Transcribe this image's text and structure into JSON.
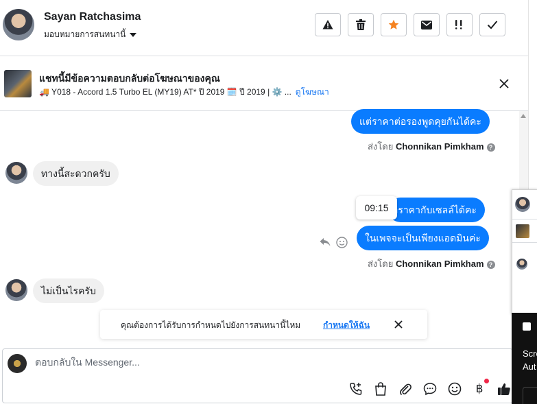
{
  "header": {
    "contact_name": "Sayan Ratchasima",
    "assign_label": "มอบหมายการสนทนานี้",
    "toolbar": {
      "spam_icon": "alert-triangle-icon",
      "delete_icon": "trash-icon",
      "star_icon": "star-icon",
      "unread_icon": "envelope-icon",
      "priority_icon": "priority-icon",
      "done_icon": "checkmark-icon",
      "star_color": "#f5821f"
    }
  },
  "ad_banner": {
    "title": "แชทนี้มีข้อความตอบกลับต่อโฆษณาของคุณ",
    "subtitle": "🚚 Y018 - Accord 1.5 Turbo EL (MY19) AT* ปี 2019 🗓️ ปี 2019 | ⚙️ ...",
    "link": "ดูโฆษณา"
  },
  "messages": [
    {
      "direction": "out",
      "text": "แต่ราคาต่อรองพูดคุยกันได้คะ"
    },
    {
      "direction": "sent_by",
      "prefix": "ส่งโดย",
      "name": "Chonnikan Pimkham"
    },
    {
      "direction": "in",
      "text": "ทางนี้สะดวกครับ"
    },
    {
      "direction": "out",
      "text": "อราคากับเซลล์ได้คะ"
    },
    {
      "direction": "out",
      "text": "ในเพจจะเป็นเพียงแอดมินค่ะ"
    },
    {
      "direction": "sent_by",
      "prefix": "ส่งโดย",
      "name": "Chonnikan Pimkham"
    },
    {
      "direction": "in",
      "text": "ไม่เป็นไรครับ"
    }
  ],
  "time_tooltip": "09:15",
  "reminder": {
    "text": "คุณต้องการได้รับการกำหนดไปยังการสนทนานี้ไหม",
    "link": "กำหนดให้ฉัน"
  },
  "composer": {
    "placeholder": "ตอบกลับใน Messenger...",
    "icons": [
      "call-add-icon",
      "shopping-bag-icon",
      "paperclip-icon",
      "chat-bubble-icon",
      "emoji-icon",
      "baht-icon",
      "thumbs-up-icon"
    ]
  },
  "side_window": {
    "line1": "Scre",
    "line2": "Aut"
  },
  "colors": {
    "accent": "#0a7cff",
    "link": "#1877f2",
    "notification_dot": "#f02849"
  }
}
